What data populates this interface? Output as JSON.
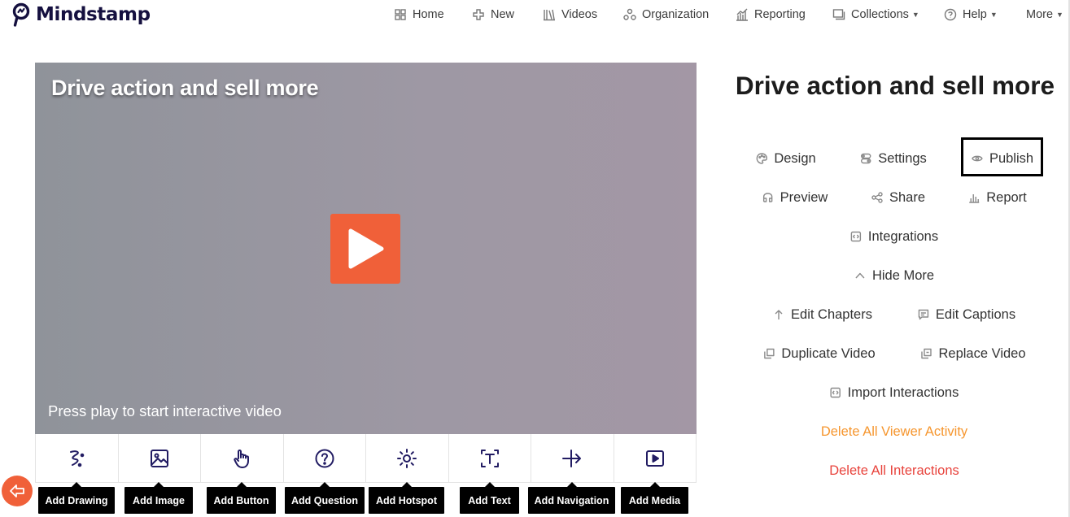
{
  "brand": {
    "name": "Mindstamp"
  },
  "nav": {
    "home": "Home",
    "new": "New",
    "videos": "Videos",
    "organization": "Organization",
    "reporting": "Reporting",
    "collections": "Collections",
    "help": "Help",
    "more": "More"
  },
  "player": {
    "title": "Drive action and sell more",
    "hint": "Press play to start interactive video"
  },
  "tools": [
    {
      "label": "Add Drawing",
      "icon": "drawing-icon"
    },
    {
      "label": "Add Image",
      "icon": "image-icon"
    },
    {
      "label": "Add Button",
      "icon": "pointer-hand-icon"
    },
    {
      "label": "Add Question",
      "icon": "question-circle-icon"
    },
    {
      "label": "Add Hotspot",
      "icon": "hotspot-sun-icon"
    },
    {
      "label": "Add Text",
      "icon": "text-frame-icon"
    },
    {
      "label": "Add Navigation",
      "icon": "navigation-arrow-icon"
    },
    {
      "label": "Add Media",
      "icon": "media-play-icon"
    }
  ],
  "panel": {
    "title": "Drive action and sell more",
    "design": "Design",
    "settings": "Settings",
    "publish": "Publish",
    "preview": "Preview",
    "share": "Share",
    "report": "Report",
    "integrations": "Integrations",
    "hide_more": "Hide More",
    "edit_chapters": "Edit Chapters",
    "edit_captions": "Edit Captions",
    "duplicate_video": "Duplicate Video",
    "replace_video": "Replace Video",
    "import_interactions": "Import Interactions",
    "delete_viewer_activity": "Delete All Viewer Activity",
    "delete_interactions": "Delete All Interactions"
  },
  "colors": {
    "accent": "#f06039",
    "brand_navy": "#15103f",
    "tool_icon": "#221c63",
    "warning_orange": "#f6962e",
    "danger_red": "#e8433c"
  }
}
